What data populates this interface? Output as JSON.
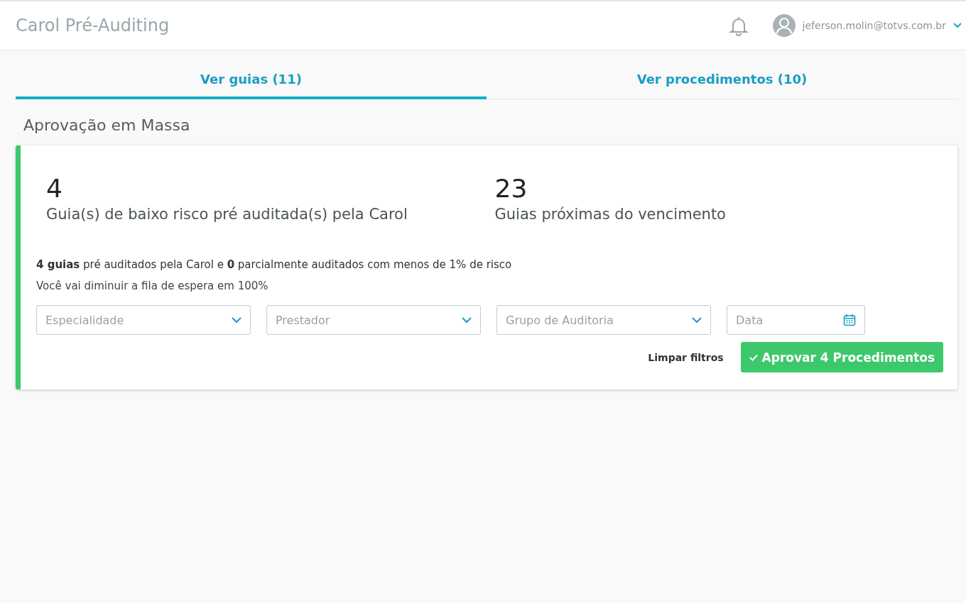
{
  "header": {
    "title": "Carol Pré-Auditing",
    "user_email": "jeferson.molin@totvs.com.br"
  },
  "tabs": [
    {
      "label": "Ver guias (11)",
      "selected": true
    },
    {
      "label": "Ver procedimentos (10)",
      "selected": false
    }
  ],
  "section_title": "Aprovação em Massa",
  "stats": [
    {
      "value": "4",
      "label": "Guia(s) de baixo risco pré auditada(s) pela Carol"
    },
    {
      "value": "23",
      "label": "Guias próximas do vencimento"
    }
  ],
  "summary": "**4 guias** pré auditados pela Carol e **0** parcialmente auditados com menos de 1% de risco",
  "queue_note": "Você vai diminuir a fila de espera em 100%",
  "filters": [
    {
      "kind": "select",
      "placeholder": "Especialidade"
    },
    {
      "kind": "select",
      "placeholder": "Prestador"
    },
    {
      "kind": "select",
      "placeholder": "Grupo de Auditoria"
    },
    {
      "kind": "date",
      "placeholder": "Data"
    }
  ],
  "clear_link": "Limpar filtros",
  "approve_button": "Aprovar 4 Procedimentos"
}
